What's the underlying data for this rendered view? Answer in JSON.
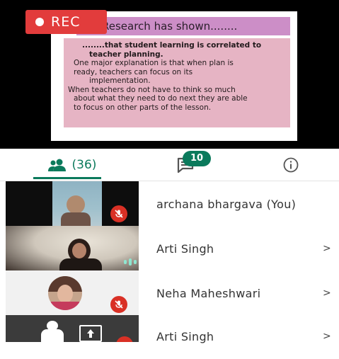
{
  "recording": {
    "label": "REC"
  },
  "slide": {
    "title": "Research has shown........",
    "lines": [
      "........that student learning is correlated to",
      "teacher planning.",
      "One major explanation is that when plan is",
      "ready, teachers can focus on its",
      "implementation.",
      "When teachers do not have to think so much",
      "about what they need to do next they are able",
      "to focus on other parts of the lesson."
    ]
  },
  "tabs": {
    "people": {
      "icon": "people-icon",
      "count": "(36)"
    },
    "chat": {
      "icon": "chat-icon",
      "badge": "10"
    },
    "info": {
      "icon": "info-icon"
    }
  },
  "participants": [
    {
      "name": "archana bhargava (You)",
      "state": "muted"
    },
    {
      "name": "Arti Singh",
      "chevron": ">",
      "state": "speaking"
    },
    {
      "name": "Neha Maheshwari",
      "chevron": ">",
      "state": "muted"
    },
    {
      "name": "Arti Singh",
      "chevron": ">",
      "state": "presenting"
    }
  ],
  "colors": {
    "accent": "#0b7a5c",
    "rec": "#e23c3c",
    "mute": "#d93025",
    "slide_title_bg": "#cc8ec7",
    "slide_body_bg": "#e6b4c4"
  }
}
